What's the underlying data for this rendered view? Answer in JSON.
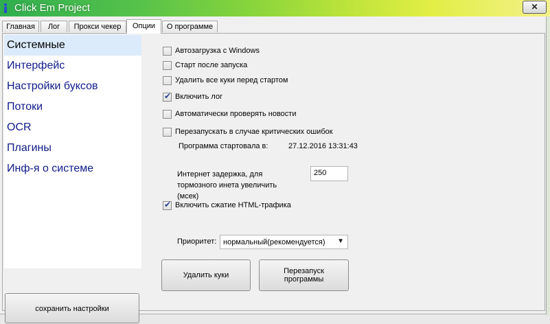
{
  "window": {
    "title": "Click Em Project",
    "close_icon": "✕"
  },
  "tabs": [
    {
      "label": "Главная"
    },
    {
      "label": "Лог"
    },
    {
      "label": "Прокси чекер"
    },
    {
      "label": "Опции",
      "active": true
    },
    {
      "label": "О программе"
    }
  ],
  "sidebar": {
    "items": [
      {
        "label": "Системные",
        "selected": true
      },
      {
        "label": "Интерфейс"
      },
      {
        "label": "Настройки буксов"
      },
      {
        "label": "Потоки"
      },
      {
        "label": "OCR"
      },
      {
        "label": "Плагины"
      },
      {
        "label": "Инф-я о системе"
      }
    ],
    "save_label": "сохранить настройки"
  },
  "options": {
    "checkboxes": [
      {
        "label": "Автозагрузка с Windows",
        "checked": false
      },
      {
        "label": "Старт после запуска",
        "checked": false
      },
      {
        "label": "Удалить все куки перед стартом",
        "checked": false
      },
      {
        "label": "Включить лог",
        "checked": true
      },
      {
        "label": "Автоматически проверять новости",
        "checked": false
      },
      {
        "label": "Перезапускать в случае критических ошибок",
        "checked": false
      }
    ],
    "start_label": "Программа стартовала в:",
    "start_value": "27.12.2016  13:31:43",
    "delay_label_1": "Интернет задержка, для",
    "delay_label_2": "тормозного инета увеличить",
    "delay_label_3": "(мсек)",
    "delay_value": "250",
    "compression_label": "Включить сжатие HTML-трафика",
    "compression_checked": true,
    "priority_label": "Приоритет:",
    "priority_value": "нормальный(рекомендуется)",
    "delete_cookies_label": "Удалить куки",
    "restart_label_1": "Перезапуск",
    "restart_label_2": "программы"
  },
  "colors": {
    "list_text": "#0e1a88",
    "selected_bg": "#dcebfb",
    "check_color": "#2a3e8e"
  }
}
